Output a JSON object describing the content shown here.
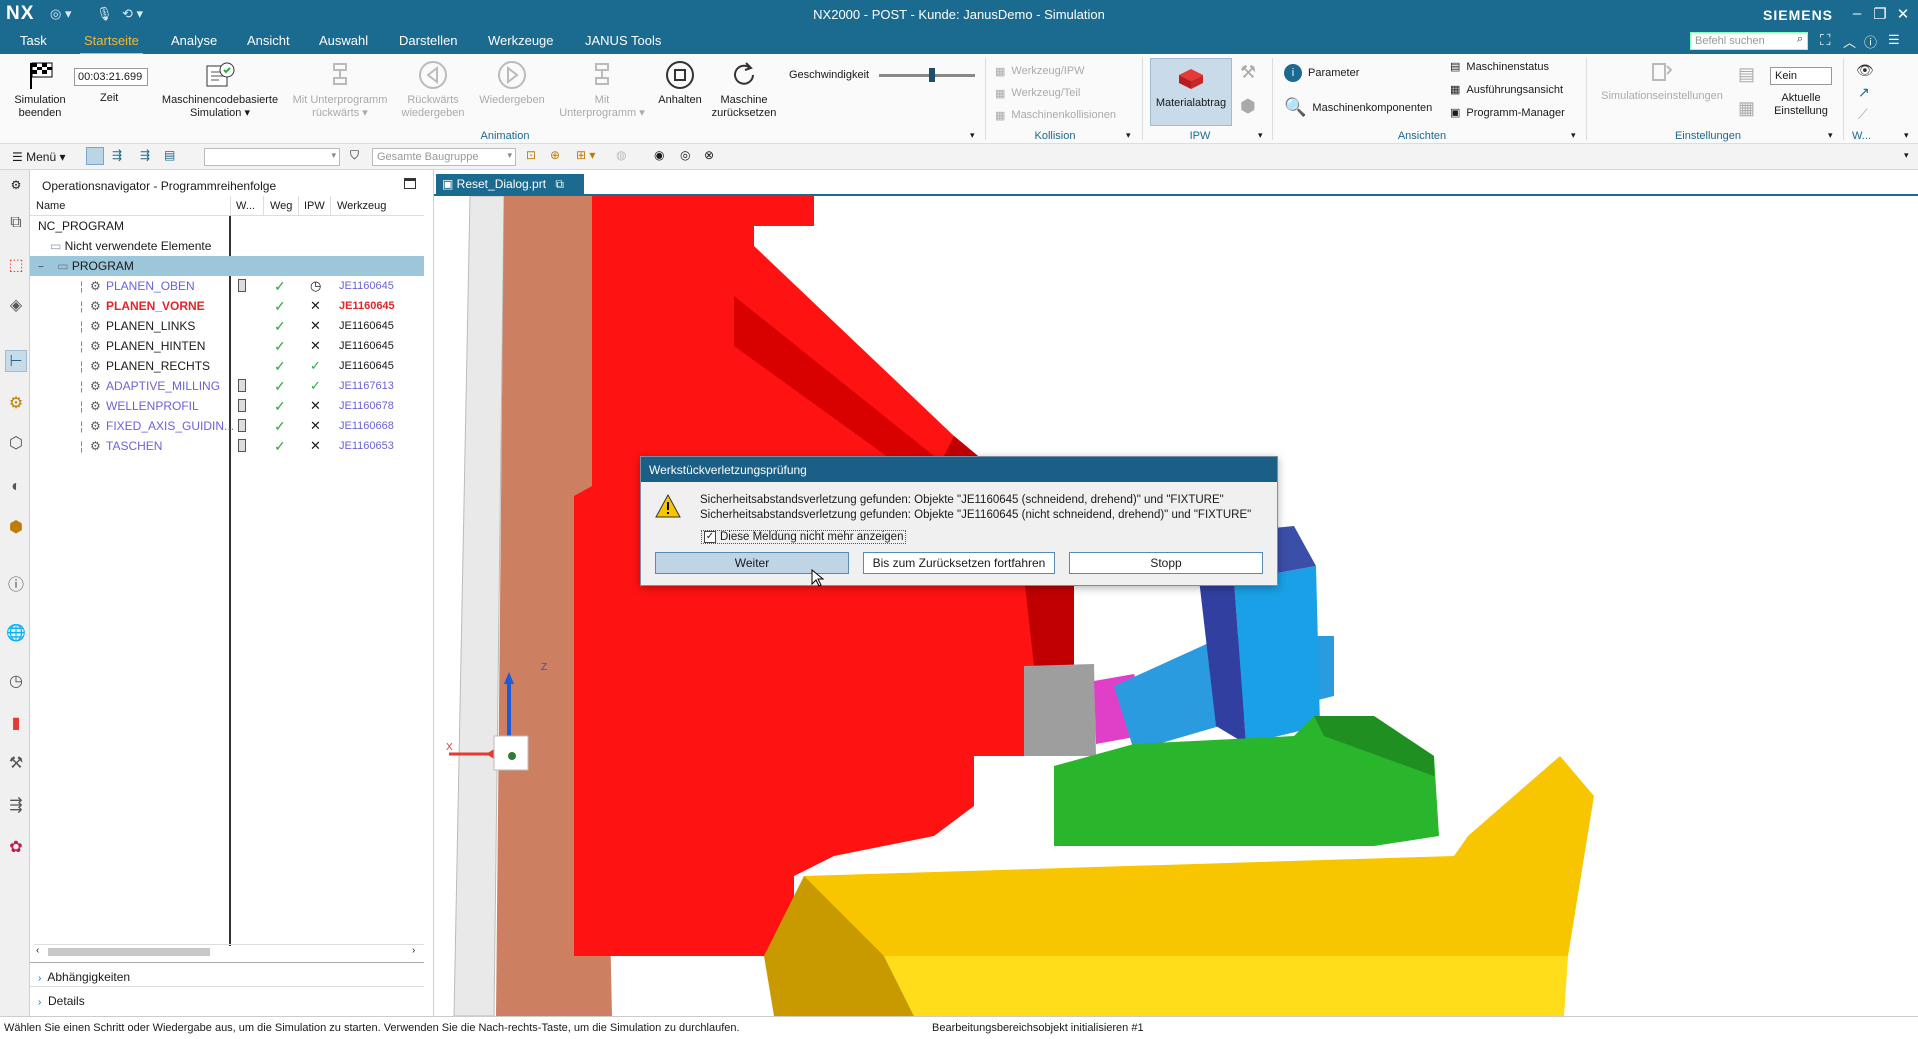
{
  "titlebar": {
    "logo": "NX",
    "title": "NX2000 - POST - Kunde: JanusDemo - Simulation",
    "brand": "SIEMENS"
  },
  "menu": {
    "tabs": [
      "Task",
      "Startseite",
      "Analyse",
      "Ansicht",
      "Auswahl",
      "Darstellen",
      "Werkzeuge",
      "JANUS Tools"
    ],
    "active": "Startseite",
    "search_placeholder": "Befehl suchen"
  },
  "ribbon": {
    "sim_end": "Simulation\nbeenden",
    "time_value": "00:03:21.699",
    "time_label": "Zeit",
    "machinecode": "Maschinencodebasierte\nSimulation ▾",
    "sub_back": "Mit Unterprogramm\nrückwärts ▾",
    "play_back": "Rückwärts\nwiedergeben",
    "play": "Wiedergeben",
    "sub_fwd": "Mit\nUnterprogramm ▾",
    "stop": "Anhalten",
    "reset": "Maschine\nzurücksetzen",
    "speed_label": "Geschwindigkeit",
    "speed_fraction": 0.55,
    "group_animation": "Animation",
    "kollision_items": [
      "Werkzeug/IPW",
      "Werkzeug/Teil",
      "Maschinenkollisionen"
    ],
    "group_kollision": "Kollision",
    "material": "Materialabtrag",
    "group_ipw": "IPW",
    "param": "Parameter",
    "machine_comp": "Maschinenkomponenten",
    "machine_status": "Maschinenstatus",
    "exec_view": "Ausführungsansicht",
    "prog_manager": "Programm-Manager",
    "group_ansichten": "Ansichten",
    "sim_settings": "Simulationseinstellungen",
    "kein": "Kein",
    "current_setting": "Aktuelle\nEinstellung",
    "group_einstellungen": "Einstellungen",
    "group_w": "W..."
  },
  "toolbar2": {
    "menu": "Menü ▾",
    "assembly": "Gesamte Baugruppe"
  },
  "navigator": {
    "title": "Operationsnavigator - Programmreihenfolge",
    "columns": [
      "Name",
      "W...",
      "Weg",
      "IPW",
      "Werkzeug"
    ],
    "root": "NC_PROGRAM",
    "unused": "Nicht verwendete Elemente",
    "program": "PROGRAM",
    "ops": [
      {
        "name": "PLANEN_OBEN",
        "tool": "JE1160645",
        "ipw": "clock",
        "w": true,
        "style": "link"
      },
      {
        "name": "PLANEN_VORNE",
        "tool": "JE1160645",
        "ipw": "x",
        "w": false,
        "style": "error"
      },
      {
        "name": "PLANEN_LINKS",
        "tool": "JE1160645",
        "ipw": "x",
        "w": false,
        "style": "normal"
      },
      {
        "name": "PLANEN_HINTEN",
        "tool": "JE1160645",
        "ipw": "x",
        "w": false,
        "style": "normal"
      },
      {
        "name": "PLANEN_RECHTS",
        "tool": "JE1160645",
        "ipw": "check",
        "w": false,
        "style": "normal"
      },
      {
        "name": "ADAPTIVE_MILLING",
        "tool": "JE1167613",
        "ipw": "check",
        "w": true,
        "style": "link"
      },
      {
        "name": "WELLENPROFIL",
        "tool": "JE1160678",
        "ipw": "x",
        "w": true,
        "style": "link"
      },
      {
        "name": "FIXED_AXIS_GUIDIN...",
        "tool": "JE1160668",
        "ipw": "x",
        "w": true,
        "style": "link"
      },
      {
        "name": "TASCHEN",
        "tool": "JE1160653",
        "ipw": "x",
        "w": true,
        "style": "link"
      }
    ],
    "deps": "Abhängigkeiten",
    "details": "Details"
  },
  "doc_tab": "Reset_Dialog.prt",
  "dialog": {
    "title": "Werkstückverletzungsprüfung",
    "line1": "Sicherheitsabstandsverletzung gefunden: Objekte \"JE1160645 (schneidend, drehend)\" und \"FIXTURE\"",
    "line2": "Sicherheitsabstandsverletzung gefunden: Objekte \"JE1160645 (nicht schneidend, drehend)\" und \"FIXTURE\"",
    "checkbox": "Diese Meldung nicht mehr anzeigen",
    "btn_continue": "Weiter",
    "btn_until_reset": "Bis zum Zurücksetzen fortfahren",
    "btn_stop": "Stopp"
  },
  "axes": {
    "x": "X",
    "z": "Z"
  },
  "status": {
    "left": "Wählen Sie einen Schritt oder Wiedergabe aus, um die Simulation zu starten. Verwenden Sie die Nach-rechts-Taste, um die Simulation zu durchlaufen.",
    "right": "Bearbeitungsbereichsobjekt initialisieren #1"
  },
  "colors": {
    "accent": "#1b6a8f",
    "highlight": "#f7b733",
    "link": "#6b62d6",
    "error": "#e3242b",
    "check": "#2eaa3a"
  }
}
